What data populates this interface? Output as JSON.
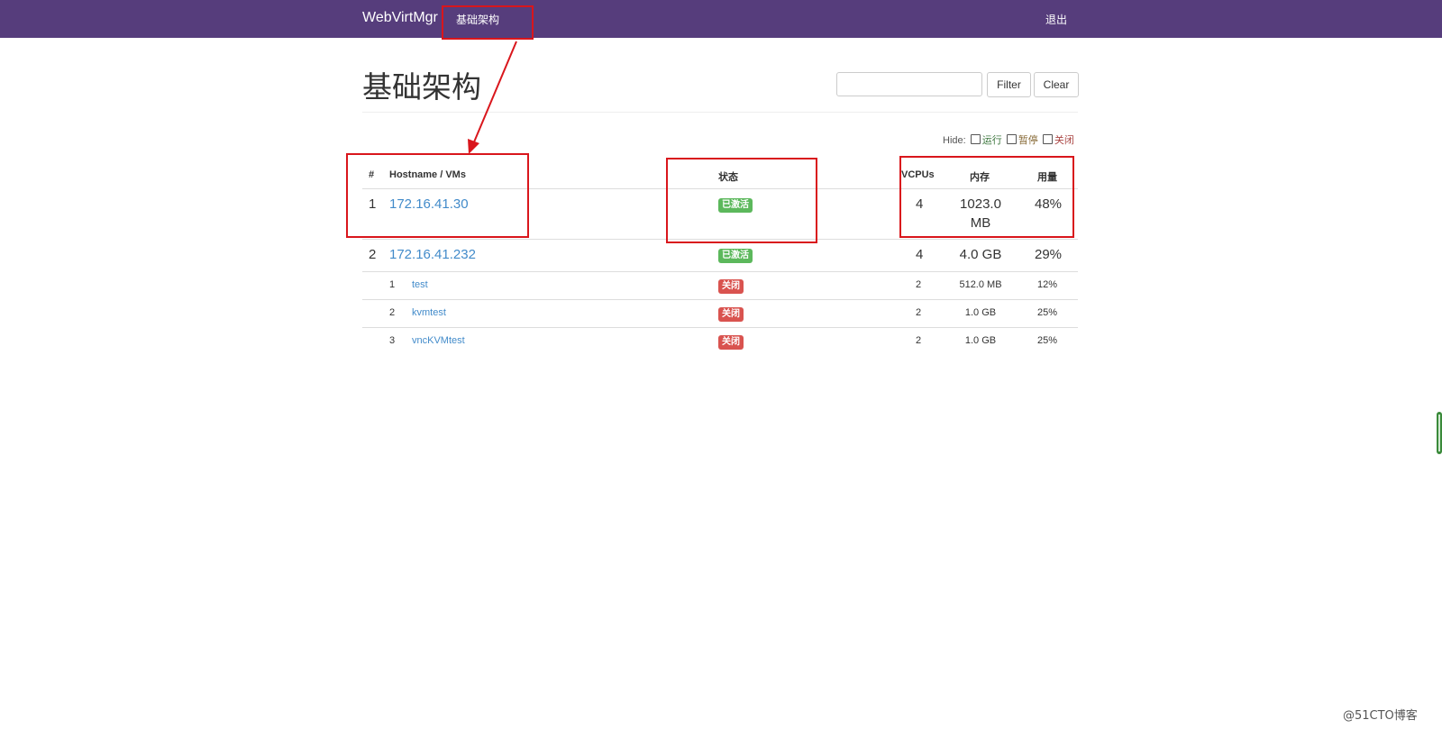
{
  "navbar": {
    "brand": "WebVirtMgr",
    "nav_item": "基础架构",
    "logout": "退出"
  },
  "header": {
    "title": "基础架构",
    "filter_placeholder": "",
    "filter_button": "Filter",
    "clear_button": "Clear"
  },
  "hide": {
    "label": "Hide:",
    "options": [
      "运行",
      "暂停",
      "关闭"
    ]
  },
  "table": {
    "columns": [
      "#",
      "Hostname / VMs",
      "状态",
      "VCPUs",
      "内存",
      "用量"
    ],
    "hosts": [
      {
        "index": "1",
        "hostname": "172.16.41.30",
        "status": "已激活",
        "vcpus": "4",
        "memory_line1": "1023.0",
        "memory_line2": "MB",
        "usage": "48%"
      },
      {
        "index": "2",
        "hostname": "172.16.41.232",
        "status": "已激活",
        "vcpus": "4",
        "memory": "4.0 GB",
        "usage": "29%",
        "vms": [
          {
            "index": "1",
            "name": "test",
            "status": "关闭",
            "vcpus": "2",
            "memory": "512.0 MB",
            "usage": "12%"
          },
          {
            "index": "2",
            "name": "kvmtest",
            "status": "关闭",
            "vcpus": "2",
            "memory": "1.0 GB",
            "usage": "25%"
          },
          {
            "index": "3",
            "name": "vncKVMtest",
            "status": "关闭",
            "vcpus": "2",
            "memory": "1.0 GB",
            "usage": "25%"
          }
        ]
      }
    ]
  },
  "colors": {
    "navbar": "#563d7c",
    "link": "#428bca",
    "success": "#5cb85c",
    "danger": "#d9534f",
    "annotation": "#d9161c"
  },
  "watermark": "@51CTO博客"
}
